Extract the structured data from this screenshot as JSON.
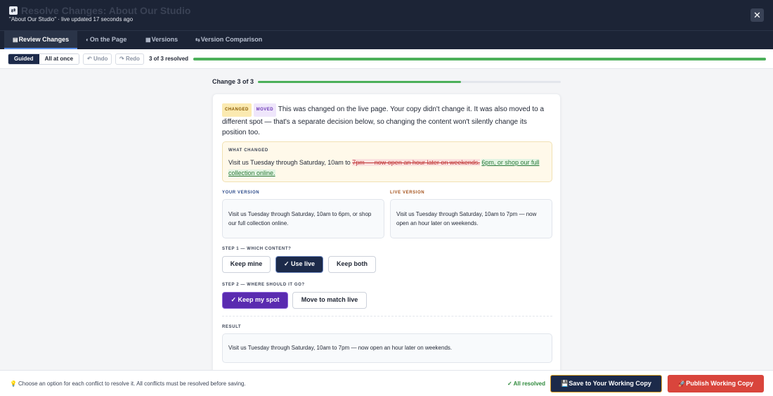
{
  "header": {
    "title": "Resolve Changes: About Our Studio",
    "subtitle": "\"About Our Studio\" · live updated 17 seconds ago",
    "app_icon": "merge-icon",
    "close_label": "✕"
  },
  "tabs": [
    {
      "label": "Review Changes",
      "icon": "review-icon",
      "active": true
    },
    {
      "label": "On the Page",
      "icon": "page-icon",
      "active": false
    },
    {
      "label": "Versions",
      "icon": "versions-icon",
      "active": false
    },
    {
      "label": "Version Comparison",
      "icon": "compare-icon",
      "active": false
    }
  ],
  "toolbar": {
    "mode_guided": "Guided",
    "mode_all": "All at once",
    "undo": "Undo",
    "redo": "Redo",
    "resolved_text": "3 of 3 resolved",
    "resolved_fraction": 1.0
  },
  "change": {
    "label": "Change 3 of 3",
    "progress_fraction": 0.67,
    "badge_changed": "CHANGED",
    "badge_moved": "MOVED",
    "intro": "This was changed on the live page. Your copy didn't change it. It was also moved to a different spot — that's a separate decision below, so changing the content won't silently change its position too.",
    "what_changed_label": "WHAT CHANGED",
    "what_common": "Visit us Tuesday through Saturday, 10am to ",
    "what_removed": "7pm — now open an hour later on weekends.",
    "what_added": "6pm, or shop our full collection online.",
    "your_version_label": "YOUR VERSION",
    "your_version_text": "Visit us Tuesday through Saturday, 10am to 6pm, or shop our full collection online.",
    "live_version_label": "LIVE VERSION",
    "live_version_text": "Visit us Tuesday through Saturday, 10am to 7pm — now open an hour later on weekends.",
    "step1_label": "STEP 1 — WHICH CONTENT?",
    "step1_options": [
      "Keep mine",
      "✓ Use live",
      "Keep both"
    ],
    "step2_label": "STEP 2 — WHERE SHOULD IT GO?",
    "step2_options": [
      "✓ Keep my spot",
      "Move to match live"
    ],
    "result_label": "RESULT",
    "result_text": "Visit us Tuesday through Saturday, 10am to 7pm — now open an hour later on weekends."
  },
  "footer": {
    "hint": "Choose an option for each conflict to resolve it. All conflicts must be resolved before saving.",
    "all_resolved": "✓ All resolved",
    "save_label": "Save to Your Working Copy",
    "publish_label": "Publish Working Copy"
  },
  "colors": {
    "header_bg": "#1c2436",
    "progress_green": "#4cb05a",
    "save_bg": "#1c2a4a",
    "publish_bg": "#d9453c",
    "use_live_bg": "#1c2a4a",
    "keep_spot_bg": "#5a2bb0"
  }
}
